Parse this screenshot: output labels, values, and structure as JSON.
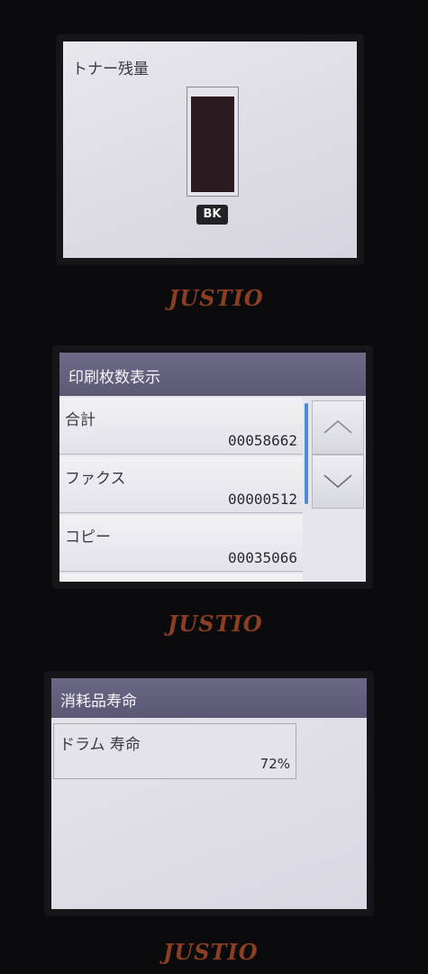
{
  "toner_screen": {
    "title": "トナー残量",
    "color_label": "BK",
    "level_percent": 95
  },
  "brand_logo": "JUSTIO",
  "counter_screen": {
    "title": "印刷枚数表示",
    "items": [
      {
        "label": "合計",
        "value": "00058662"
      },
      {
        "label": "ファクス",
        "value": "00000512"
      },
      {
        "label": "コピー",
        "value": "00035066"
      }
    ],
    "scroll_up_icon": "chevron-up",
    "scroll_down_icon": "chevron-down"
  },
  "consumables_screen": {
    "title": "消耗品寿命",
    "drum_label": "ドラム 寿命",
    "drum_value": "72%"
  }
}
